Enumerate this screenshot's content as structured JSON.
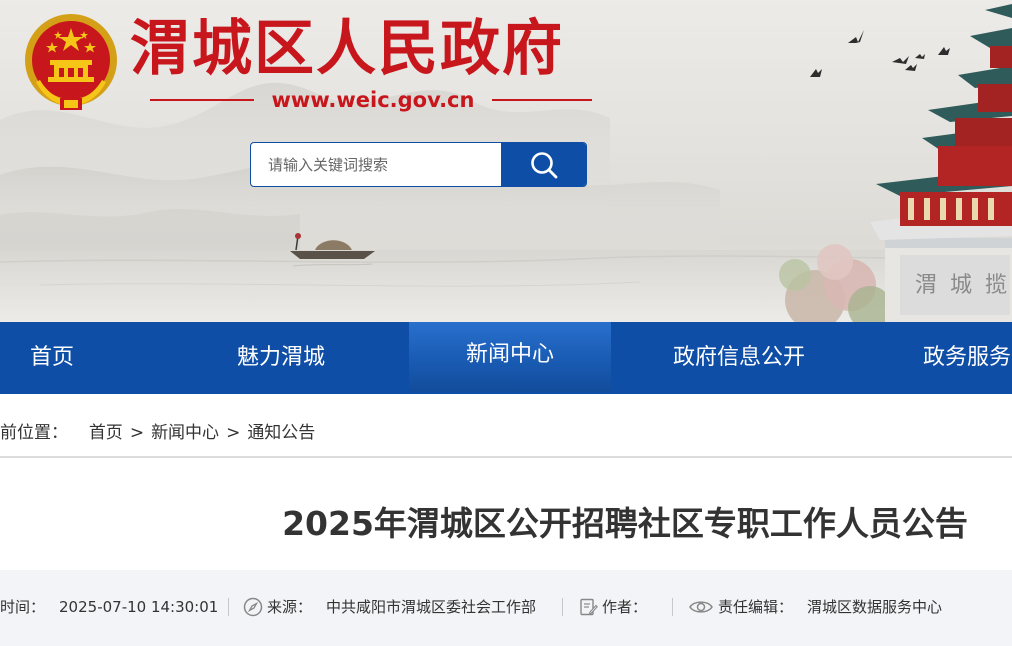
{
  "header": {
    "site_title": "渭城区人民政府",
    "site_url": "www.weic.gov.cn",
    "emblem_icon": "national-emblem-icon",
    "brand_color": "#c8161d",
    "accent_color": "#0f4ea6"
  },
  "search": {
    "placeholder": "请输入关键词搜索",
    "button_icon": "search-icon"
  },
  "nav": {
    "items": [
      {
        "label": "首页"
      },
      {
        "label": "魅力渭城"
      },
      {
        "label": "新闻中心",
        "active": true
      },
      {
        "label": "政府信息公开"
      },
      {
        "label": "政务服务"
      }
    ]
  },
  "breadcrumb": {
    "prefix": "前位置：",
    "items": [
      "首页",
      "新闻中心",
      "通知公告"
    ],
    "separator": ">"
  },
  "article": {
    "title": "2025年渭城区公开招聘社区专职工作人员公告",
    "meta": {
      "time_label": "时间：",
      "time_value": "2025-07-10 14:30:01",
      "source_label": "来源：",
      "source_value": "中共咸阳市渭城区委社会工作部",
      "author_label": "作者：",
      "author_value": "",
      "editor_label": "责任编辑：",
      "editor_value": "渭城区数据服务中心"
    }
  }
}
